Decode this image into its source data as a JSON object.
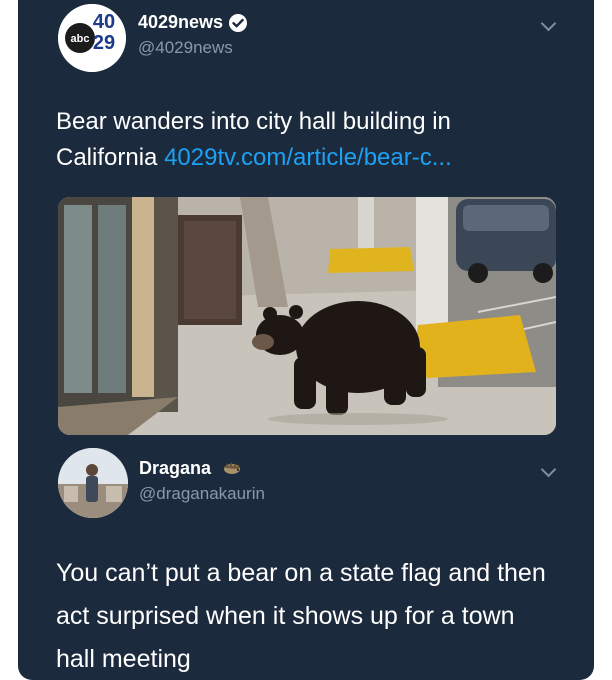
{
  "tweet": {
    "display_name": "4029news",
    "handle": "@4029news",
    "avatar_logo": "abc 40 29",
    "text": "Bear wanders into city hall building in California",
    "link": "4029tv.com/article/bear-c...",
    "verified_icon": "verified-badge-icon",
    "menu_icon": "chevron-down-icon"
  },
  "reply": {
    "display_name": "Dragana",
    "handle": "@draganakaurin",
    "name_emoji": "hedgehog-emoji-icon",
    "menu_icon": "chevron-down-icon",
    "text": "You can’t put a bear on a state flag and then act surprised when it shows up for a town hall meeting"
  },
  "colors": {
    "background": "#1c2a3d",
    "link": "#1da1f2",
    "handle": "#8899ac"
  }
}
